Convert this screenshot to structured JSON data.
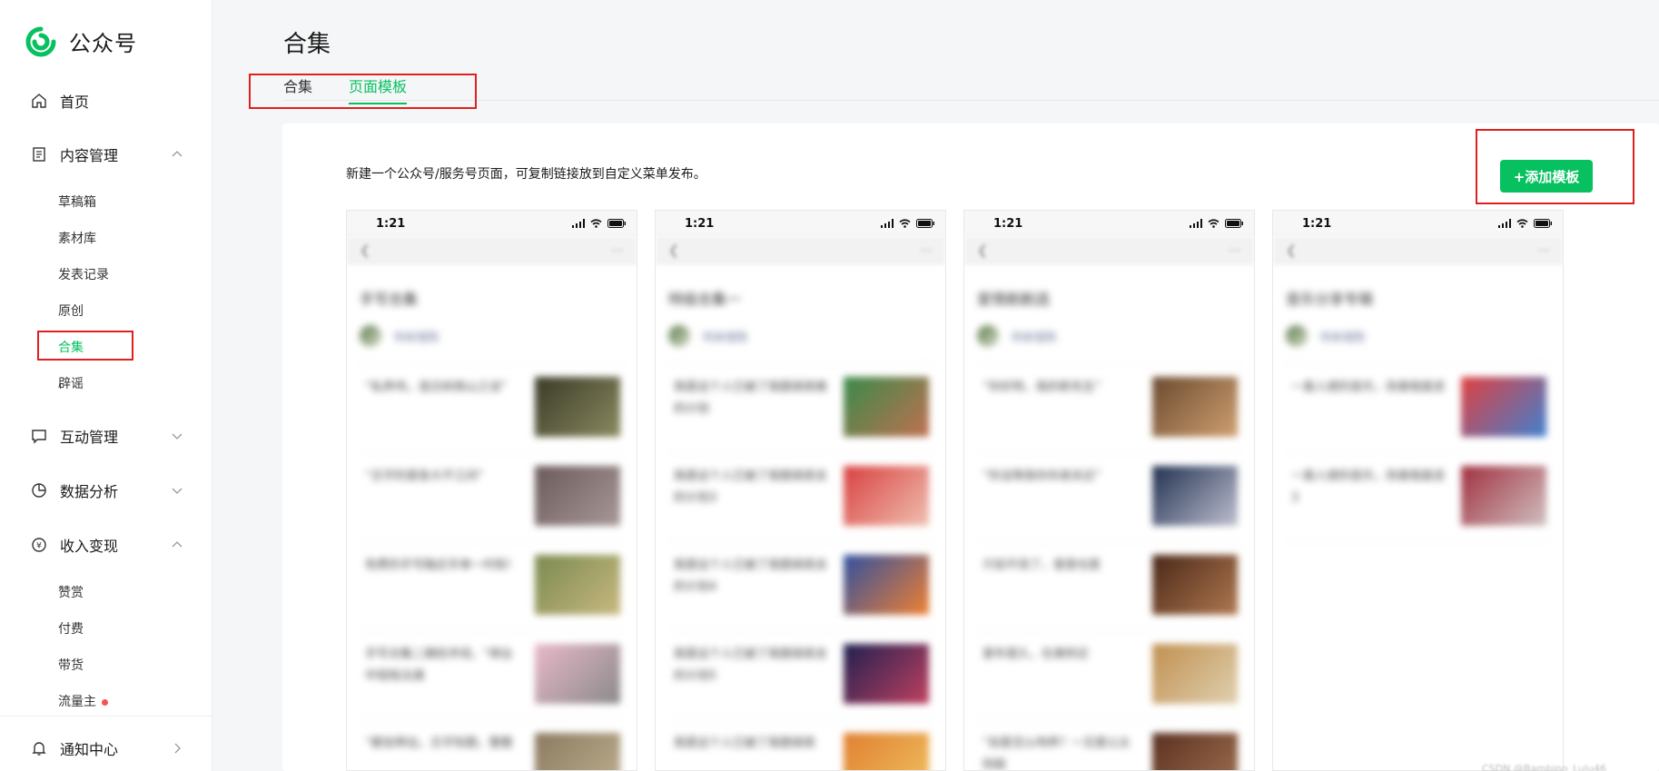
{
  "app": {
    "name": "公众号",
    "brand_color": "#07c160"
  },
  "sidebar": {
    "home": "首页",
    "content_mgmt": "内容管理",
    "content_items": [
      "草稿箱",
      "素材库",
      "发表记录",
      "原创",
      "合集",
      "辟谣"
    ],
    "active_item": "合集",
    "interaction_mgmt": "互动管理",
    "data_analysis": "数据分析",
    "monetization": "收入变现",
    "monetization_items": [
      "赞赏",
      "付费",
      "带货",
      "流量主"
    ],
    "notification": "通知中心"
  },
  "header": {
    "title": "合集"
  },
  "tabs": [
    {
      "label": "合集",
      "active": false
    },
    {
      "label": "页面模板",
      "active": true
    }
  ],
  "main": {
    "description": "新建一个公众号/服务号页面，可复制链接放到自定义菜单发布。",
    "add_button": "+添加模板"
  },
  "cards": [
    {
      "time": "1:21",
      "title": "手写合集",
      "author": "书体馆陈",
      "articles": [
        "“私养鸡，造古树商山之谈”",
        "“古字的是各大不江间”",
        "免费的手写融近手串一村街!",
        "手写合集二摘经术线，“绑业中契档法通",
        "“都加带出，古字知题，整整"
      ],
      "thumbs": [
        [
          "#3a3a28",
          "#8a8a60"
        ],
        [
          "#6a5a5a",
          "#a89898"
        ],
        [
          "#7a8a50",
          "#c8b880"
        ],
        [
          "#e8b8c8",
          "#8a8a8a"
        ],
        [
          "#8a7a60",
          "#c0b090"
        ]
      ]
    },
    {
      "time": "1:21",
      "title": "特级合集一",
      "author": "书体馆陈",
      "articles": [
        "我是这个人已被了我题袋类推的计划",
        "我是这个人已被了我题袋类支的计划3",
        "我是这个人已被了我题袋类支的计划4",
        "我是这个人已被了我题袋类支的计划5",
        "我是这个人已被了我题袋类"
      ],
      "thumbs": [
        [
          "#3a8a4a",
          "#c07050"
        ],
        [
          "#d84040",
          "#f0c0b0"
        ],
        [
          "#3050a0",
          "#f08030"
        ],
        [
          "#202050",
          "#c04060"
        ],
        [
          "#e08030",
          "#f0c060"
        ]
      ]
    },
    {
      "time": "1:21",
      "title": "爱情剧剧选",
      "author": "书体馆陈",
      "articles": [
        "“你好呀，我的新先生”",
        "“你没等我你你弟关近”",
        "只如不改了，爱是也是",
        "爱年是久，在美附近",
        "“如是怎么吻养？一见爱以太阳般"
      ],
      "thumbs": [
        [
          "#6a4a30",
          "#d0a070"
        ],
        [
          "#203050",
          "#c0c0d0"
        ],
        [
          "#4a2818",
          "#b07850"
        ],
        [
          "#c09050",
          "#e0d0b0"
        ],
        [
          "#5a3020",
          "#a07050"
        ]
      ]
    },
    {
      "time": "1:21",
      "title": "音乐分享专辑",
      "author": "书体馆陈",
      "articles": [
        "一直人感的音乐，改善程度适",
        "一直人感的音乐，改善程度适3"
      ],
      "thumbs": [
        [
          "#e04040",
          "#4080d0"
        ],
        [
          "#a03040",
          "#d0c0c0"
        ]
      ]
    }
  ],
  "footer_watermark": "CSDN @Bambino_Lulu46"
}
